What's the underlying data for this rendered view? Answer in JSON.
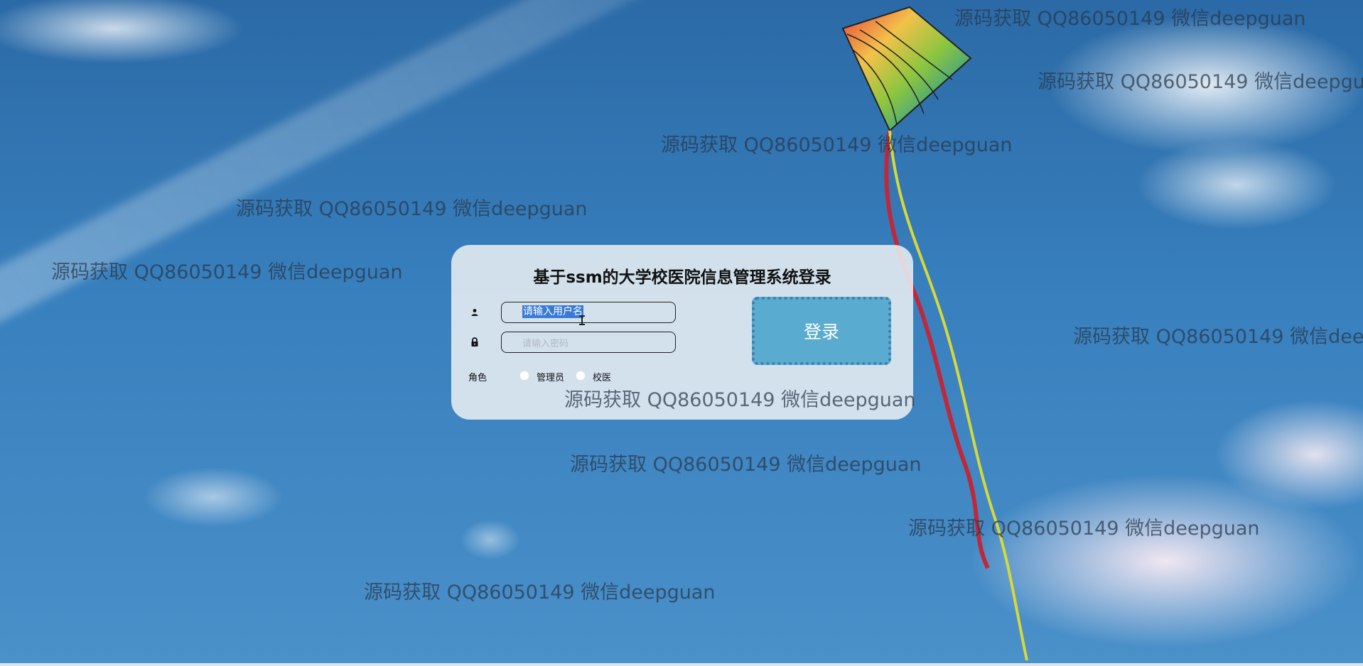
{
  "page": {
    "watermark_text": "源码获取 QQ86050149 微信deepguan"
  },
  "login": {
    "title": "基于ssm的大学校医院信息管理系统登录",
    "username": {
      "value": "请输入用户名",
      "placeholder": "请输入用户名",
      "icon": "user-icon"
    },
    "password": {
      "value": "",
      "placeholder": "请输入密码",
      "icon": "lock-icon"
    },
    "role_label": "角色",
    "roles": [
      {
        "label": "管理员",
        "selected": false
      },
      {
        "label": "校医",
        "selected": false
      }
    ],
    "submit_label": "登录"
  },
  "colors": {
    "sky": "#2b6aa6",
    "card": "#e8eef3",
    "button": "#5aabd0",
    "button_border": "#3d7fae",
    "selection": "#3a7bd5"
  }
}
